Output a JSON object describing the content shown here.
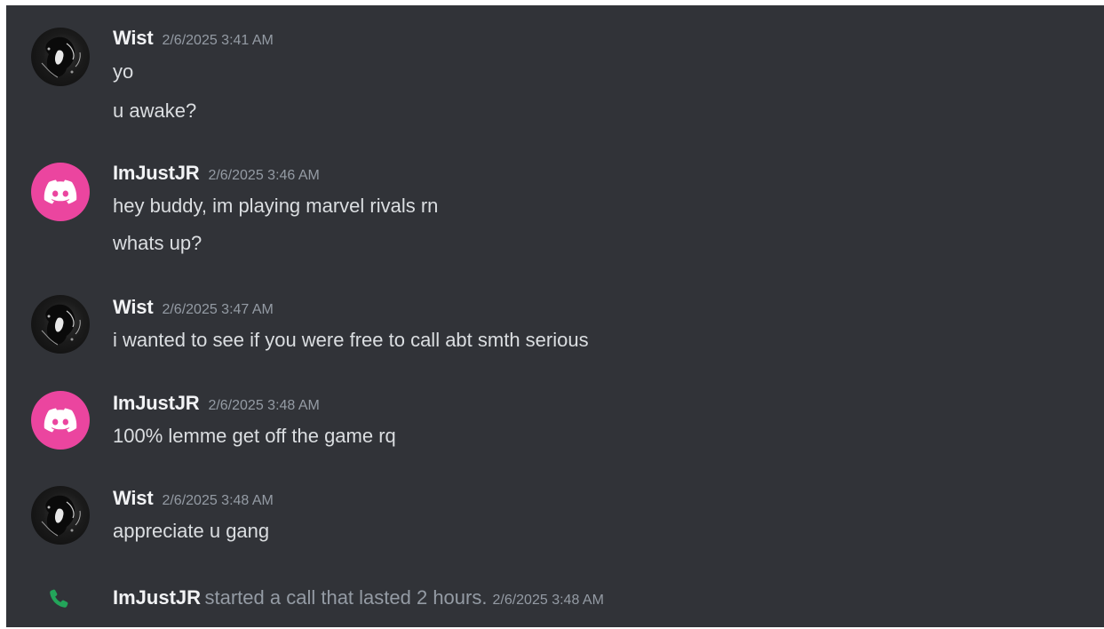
{
  "messages": [
    {
      "author": "Wist",
      "timestamp": "2/6/2025 3:41 AM",
      "avatar_icon": "wist-avatar",
      "lines": [
        "yo",
        "u awake?"
      ]
    },
    {
      "author": "ImJustJR",
      "timestamp": "2/6/2025 3:46 AM",
      "avatar_icon": "discord-logo-icon",
      "lines": [
        "hey buddy, im playing marvel rivals rn",
        "whats up?"
      ]
    },
    {
      "author": "Wist",
      "timestamp": "2/6/2025 3:47 AM",
      "avatar_icon": "wist-avatar",
      "lines": [
        "i wanted to see if you were free to call abt smth serious"
      ]
    },
    {
      "author": "ImJustJR",
      "timestamp": "2/6/2025 3:48 AM",
      "avatar_icon": "discord-logo-icon",
      "lines": [
        "100% lemme get off the game rq"
      ]
    },
    {
      "author": "Wist",
      "timestamp": "2/6/2025 3:48 AM",
      "avatar_icon": "wist-avatar",
      "lines": [
        "appreciate u gang"
      ]
    }
  ],
  "call_event": {
    "author": "ImJustJR",
    "description": "started a call that lasted 2 hours.",
    "timestamp": "2/6/2025 3:48 AM",
    "icon": "phone-icon"
  },
  "colors": {
    "background": "#313338",
    "author_text": "#f2f3f5",
    "message_text": "#dbdee1",
    "timestamp_text": "#949ba4",
    "discord_avatar": "#eb459f",
    "call_icon": "#23a55a"
  }
}
